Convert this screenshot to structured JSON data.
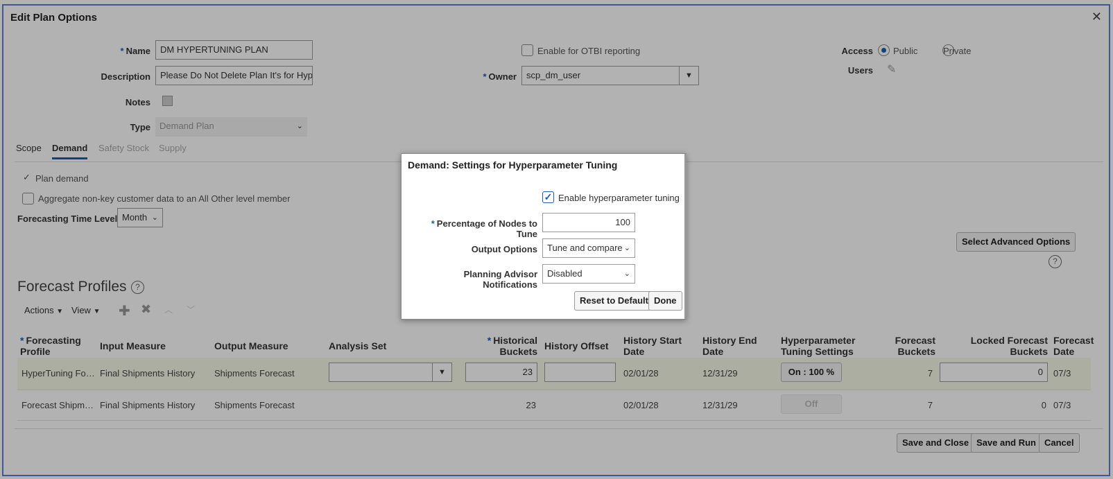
{
  "window": {
    "title": "Edit Plan Options"
  },
  "form": {
    "name_label": "Name",
    "name_value": "DM HYPERTUNING PLAN",
    "description_label": "Description",
    "description_value": "Please Do Not Delete Plan It's for Hype",
    "notes_label": "Notes",
    "type_label": "Type",
    "type_value": "Demand Plan",
    "otbi_label": "Enable for OTBI reporting",
    "owner_label": "Owner",
    "owner_value": "scp_dm_user",
    "access_label": "Access",
    "access_public": "Public",
    "access_private": "Private",
    "users_label": "Users"
  },
  "tabs": [
    {
      "label": "Scope"
    },
    {
      "label": "Demand"
    },
    {
      "label": "Safety Stock"
    },
    {
      "label": "Supply"
    }
  ],
  "demand": {
    "plan_demand": "Plan demand",
    "aggregate_label": "Aggregate non-key customer data to an All Other level member",
    "time_level_label": "Forecasting Time Level",
    "time_level_value": "Month",
    "advanced_button": "Select Advanced Options"
  },
  "profiles": {
    "title": "Forecast Profiles",
    "actions": "Actions",
    "view": "View",
    "headers": {
      "forecasting_profile": "Forecasting Profile",
      "input_measure": "Input Measure",
      "output_measure": "Output Measure",
      "analysis_set": "Analysis Set",
      "historical_buckets": "Historical Buckets",
      "history_offset": "History Offset",
      "history_start": "History Start Date",
      "history_end": "History End Date",
      "hyper_settings": "Hyperparameter Tuning Settings",
      "forecast_buckets": "Forecast Buckets",
      "locked_buckets": "Locked Forecast Buckets",
      "forecast_date": "Forecast Date"
    },
    "rows": [
      {
        "profile": "HyperTuning Fo…",
        "input": "Final Shipments History",
        "output": "Shipments Forecast",
        "hist_buckets": "23",
        "start": "02/01/28",
        "end": "12/31/29",
        "tuning": "On : 100 %",
        "fc_buckets": "7",
        "locked": "0",
        "fc_date": "07/3"
      },
      {
        "profile": "Forecast Shipm…",
        "input": "Final Shipments History",
        "output": "Shipments Forecast",
        "hist_buckets": "23",
        "start": "02/01/28",
        "end": "12/31/29",
        "tuning": "Off",
        "fc_buckets": "7",
        "locked": "0",
        "fc_date": "07/3"
      }
    ]
  },
  "footer": {
    "save_close": "Save and Close",
    "save_run": "Save and Run",
    "cancel": "Cancel"
  },
  "dialog": {
    "title": "Demand: Settings for Hyperparameter Tuning",
    "enable_label": "Enable hyperparameter tuning",
    "pct_label": "Percentage of Nodes to Tune",
    "pct_value": "100",
    "output_label": "Output Options",
    "output_value": "Tune and compare",
    "notif_label": "Planning Advisor Notifications",
    "notif_value": "Disabled",
    "reset_button": "Reset to Default",
    "done_button": "Done"
  },
  "colors": {
    "accent": "#1a5fb4",
    "frame": "#5b7fd6",
    "row_highlight": "#f7f9e9"
  }
}
